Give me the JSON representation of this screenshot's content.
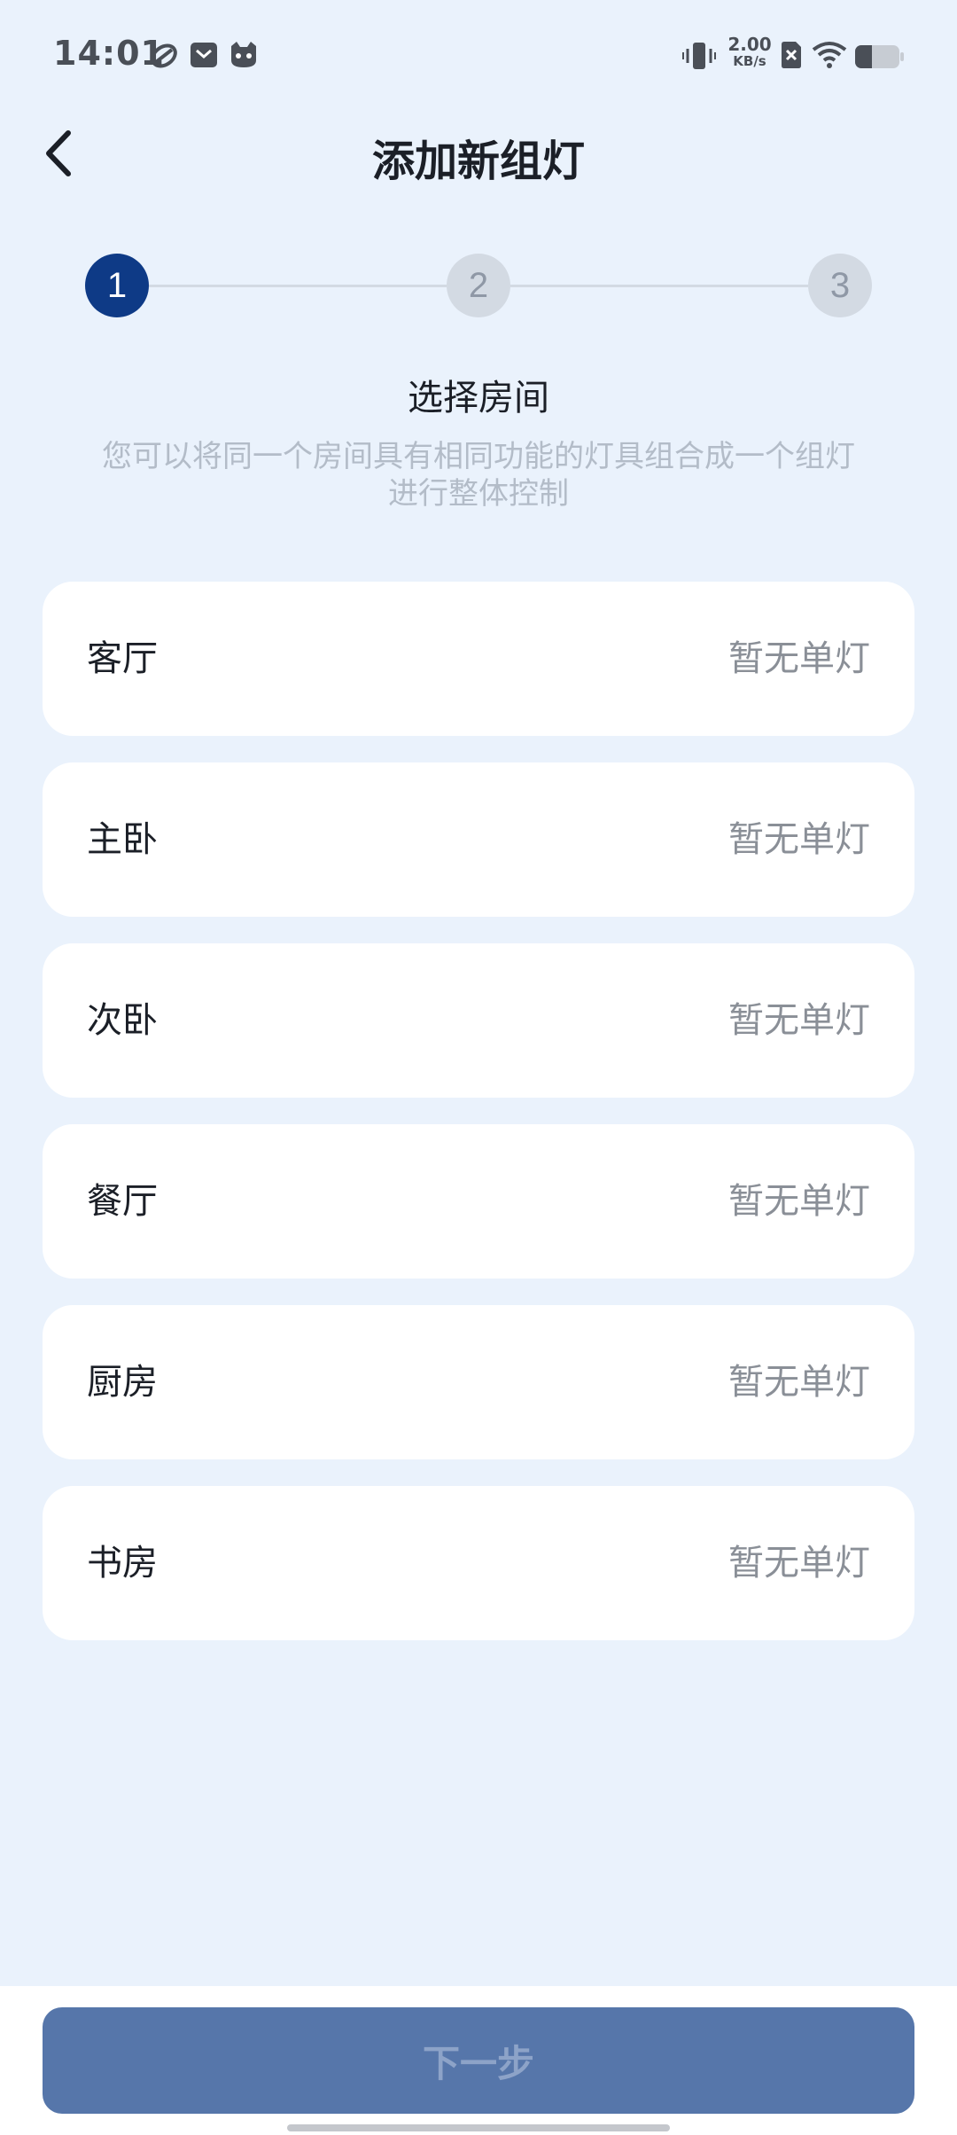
{
  "status_bar": {
    "time": "14:01",
    "net_speed_value": "2.00",
    "net_speed_unit": "KB/s",
    "left_icons": [
      "app-notification-icon",
      "mail-icon",
      "cat-app-icon"
    ],
    "right_icons": [
      "vibrate-icon",
      "no-sim-icon",
      "wifi-icon",
      "battery-icon"
    ]
  },
  "header": {
    "title": "添加新组灯",
    "back_icon": "chevron-left-icon"
  },
  "stepper": {
    "current": 1,
    "steps": [
      "1",
      "2",
      "3"
    ]
  },
  "section": {
    "title": "选择房间",
    "description": "您可以将同一个房间具有相同功能的灯具组合成一个组灯进行整体控制"
  },
  "rooms": [
    {
      "name": "客厅",
      "status": "暂无单灯"
    },
    {
      "name": "主卧",
      "status": "暂无单灯"
    },
    {
      "name": "次卧",
      "status": "暂无单灯"
    },
    {
      "name": "餐厅",
      "status": "暂无单灯"
    },
    {
      "name": "厨房",
      "status": "暂无单灯"
    },
    {
      "name": "书房",
      "status": "暂无单灯"
    }
  ],
  "footer": {
    "next_label": "下一步"
  },
  "colors": {
    "background": "#EAF2FC",
    "accent": "#0E3A86",
    "button": "#5676AA"
  }
}
